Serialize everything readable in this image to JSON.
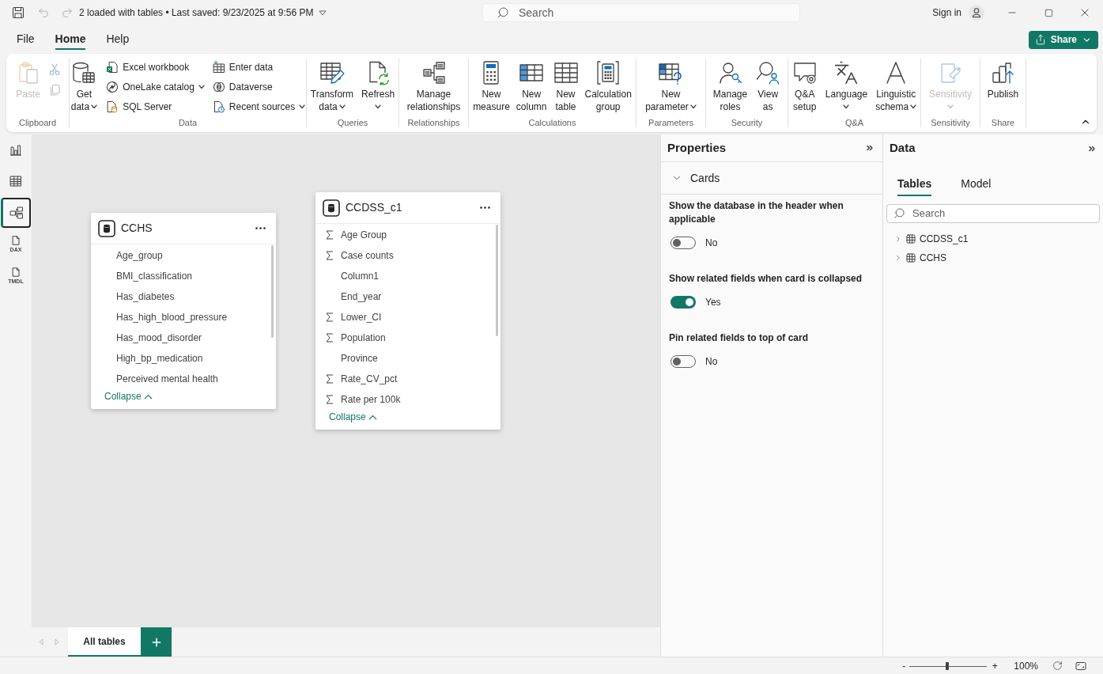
{
  "title_bar": {
    "title": "2 loaded with tables • Last saved: 9/23/2025 at 9:56 PM",
    "search": {
      "placeholder": "Search"
    },
    "sign_in": "Sign in"
  },
  "menu_tabs": [
    {
      "label": "File",
      "selected": false
    },
    {
      "label": "Home",
      "selected": true
    },
    {
      "label": "Help",
      "selected": false
    }
  ],
  "share_button": {
    "label": "Share"
  },
  "ribbon": {
    "groups": [
      {
        "label": "Clipboard",
        "items": [
          {
            "kind": "large",
            "lines": [
              "Paste"
            ],
            "dropdown": false,
            "disabled": true
          },
          {
            "kind": "icon_stack",
            "buttons": [
              {
                "disabled": true
              },
              {
                "disabled": true
              }
            ]
          }
        ]
      },
      {
        "label": "Data",
        "items": [
          {
            "kind": "large",
            "lines": [
              "Get",
              "data"
            ],
            "dropdown": true,
            "disabled": false
          },
          {
            "kind": "small_stack",
            "buttons": [
              {
                "label": "Excel workbook",
                "dropdown": false
              },
              {
                "label": "OneLake catalog",
                "dropdown": true
              },
              {
                "label": "SQL Server",
                "dropdown": false
              }
            ]
          },
          {
            "kind": "small_stack",
            "buttons": [
              {
                "label": "Enter data",
                "dropdown": false
              },
              {
                "label": "Dataverse",
                "dropdown": false
              },
              {
                "label": "Recent sources",
                "dropdown": true
              }
            ]
          }
        ]
      },
      {
        "label": "Queries",
        "items": [
          {
            "kind": "large",
            "lines": [
              "Transform",
              "data"
            ],
            "dropdown": true,
            "disabled": false
          },
          {
            "kind": "large",
            "lines": [
              "Refresh"
            ],
            "dropdown": true,
            "disabled": false
          }
        ]
      },
      {
        "label": "Relationships",
        "items": [
          {
            "kind": "large",
            "lines": [
              "Manage",
              "relationships"
            ],
            "dropdown": false,
            "disabled": false
          }
        ]
      },
      {
        "label": "Calculations",
        "items": [
          {
            "kind": "large",
            "lines": [
              "New",
              "measure"
            ],
            "dropdown": false,
            "disabled": false
          },
          {
            "kind": "large",
            "lines": [
              "New",
              "column"
            ],
            "dropdown": false,
            "disabled": false
          },
          {
            "kind": "large",
            "lines": [
              "New",
              "table"
            ],
            "dropdown": false,
            "disabled": false
          },
          {
            "kind": "large",
            "lines": [
              "Calculation",
              "group"
            ],
            "dropdown": false,
            "disabled": false
          }
        ]
      },
      {
        "label": "Parameters",
        "items": [
          {
            "kind": "large",
            "lines": [
              "New",
              "parameter"
            ],
            "dropdown": true,
            "disabled": false
          }
        ]
      },
      {
        "label": "Security",
        "items": [
          {
            "kind": "large",
            "lines": [
              "Manage",
              "roles"
            ],
            "dropdown": false,
            "disabled": false
          },
          {
            "kind": "large",
            "lines": [
              "View",
              "as"
            ],
            "dropdown": false,
            "disabled": false
          }
        ]
      },
      {
        "label": "Q&A",
        "items": [
          {
            "kind": "large",
            "lines": [
              "Q&A",
              "setup"
            ],
            "dropdown": false,
            "disabled": false
          },
          {
            "kind": "large",
            "lines": [
              "Language"
            ],
            "dropdown": true,
            "disabled": false
          },
          {
            "kind": "large",
            "lines": [
              "Linguistic",
              "schema"
            ],
            "dropdown": true,
            "disabled": false
          }
        ]
      },
      {
        "label": "Sensitivity",
        "items": [
          {
            "kind": "large",
            "lines": [
              "Sensitivity"
            ],
            "dropdown": true,
            "disabled": true
          }
        ]
      },
      {
        "label": "Share",
        "items": [
          {
            "kind": "large",
            "lines": [
              "Publish"
            ],
            "dropdown": false,
            "disabled": false
          }
        ]
      }
    ]
  },
  "view_nav": [
    {
      "selected": false
    },
    {
      "selected": false
    },
    {
      "selected": true
    },
    {
      "caption": "DAX",
      "selected": false
    },
    {
      "caption": "TMDL",
      "selected": false
    }
  ],
  "model_view": {
    "cards": [
      {
        "name": "CCHS",
        "fields": [
          {
            "name": "Age_group",
            "kind": "text"
          },
          {
            "name": "BMI_classification",
            "kind": "text"
          },
          {
            "name": "Has_diabetes",
            "kind": "text"
          },
          {
            "name": "Has_high_blood_pressure",
            "kind": "text"
          },
          {
            "name": "Has_mood_disorder",
            "kind": "text"
          },
          {
            "name": "High_bp_medication",
            "kind": "text"
          },
          {
            "name": "Perceived mental health",
            "kind": "text"
          }
        ],
        "collapse_link": "Collapse"
      },
      {
        "name": "CCDSS_c1",
        "fields": [
          {
            "name": "Age Group",
            "kind": "sum"
          },
          {
            "name": "Case counts",
            "kind": "sum"
          },
          {
            "name": "Column1",
            "kind": "text"
          },
          {
            "name": "End_year",
            "kind": "text"
          },
          {
            "name": "Lower_CI",
            "kind": "sum"
          },
          {
            "name": "Population",
            "kind": "sum"
          },
          {
            "name": "Province",
            "kind": "text"
          },
          {
            "name": "Rate_CV_pct",
            "kind": "sum"
          },
          {
            "name": "Rate per 100k",
            "kind": "sum"
          }
        ],
        "collapse_link": "Collapse"
      }
    ],
    "page_tabs": [
      {
        "label": "All tables",
        "selected": true
      }
    ]
  },
  "properties_pane": {
    "title": "Properties",
    "section": {
      "label": "Cards",
      "expanded": true
    },
    "settings": [
      {
        "label": "Show the database in the header when applicable",
        "on": false,
        "value_label": "No"
      },
      {
        "label": "Show related fields when card is collapsed",
        "on": true,
        "value_label": "Yes"
      },
      {
        "label": "Pin related fields to top of card",
        "on": false,
        "value_label": "No"
      }
    ]
  },
  "data_pane": {
    "title": "Data",
    "tabs": [
      {
        "label": "Tables",
        "selected": true
      },
      {
        "label": "Model",
        "selected": false
      }
    ],
    "search": {
      "placeholder": "Search"
    },
    "tables": [
      {
        "name": "CCDSS_c1",
        "expanded": false
      },
      {
        "name": "CCHS",
        "expanded": false
      }
    ]
  },
  "status_bar": {
    "zoom": {
      "minus": "-",
      "plus": "+",
      "level": 0.49,
      "reading": "100%"
    }
  }
}
